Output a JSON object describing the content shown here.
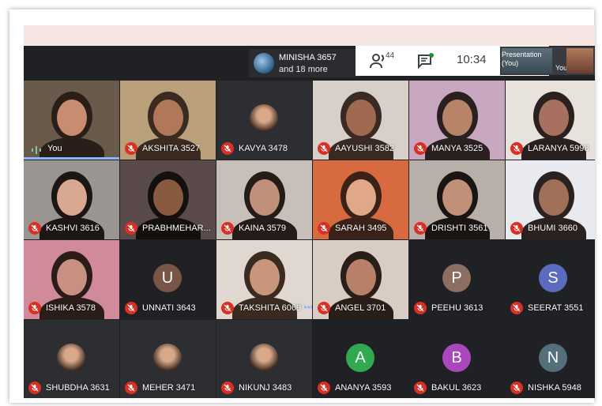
{
  "presenter": {
    "name": "MINISHA 3657",
    "more": "and 18 more"
  },
  "controls": {
    "people_count": "44",
    "time": "10:34"
  },
  "presentation_thumb": {
    "label_line1": "Presentation",
    "label_line2": "(You)",
    "you": "You"
  },
  "tiles": [
    {
      "name": "You",
      "type": "video",
      "self": true
    },
    {
      "name": "AKSHITA 3527",
      "type": "video"
    },
    {
      "name": "KAVYA 3478",
      "type": "photo"
    },
    {
      "name": "AAYUSHI 3582",
      "type": "video"
    },
    {
      "name": "MANYA 3525",
      "type": "video"
    },
    {
      "name": "LARANYA 5998",
      "type": "video"
    },
    {
      "name": "KASHVI 3616",
      "type": "video"
    },
    {
      "name": "PRABHMEHAR...",
      "type": "video"
    },
    {
      "name": "KAINA 3579",
      "type": "video"
    },
    {
      "name": "SARAH 3495",
      "type": "video"
    },
    {
      "name": "DRISHTI 3561",
      "type": "video"
    },
    {
      "name": "BHUMI 3660",
      "type": "video"
    },
    {
      "name": "ISHIKA 3578",
      "type": "video"
    },
    {
      "name": "UNNATI 3643",
      "type": "letter",
      "letter": "U",
      "color": "#795548"
    },
    {
      "name": "TAKSHITA 6069",
      "type": "video"
    },
    {
      "name": "ANGEL 3701",
      "type": "video"
    },
    {
      "name": "PEEHU 3613",
      "type": "letter",
      "letter": "P",
      "color": "#8d6e63"
    },
    {
      "name": "SEERAT 3551",
      "type": "letter",
      "letter": "S",
      "color": "#5c6bc0"
    },
    {
      "name": "SHUBDHA 3631",
      "type": "photo"
    },
    {
      "name": "MEHER 3471",
      "type": "photo"
    },
    {
      "name": "NIKUNJ 3483",
      "type": "photo"
    },
    {
      "name": "ANANYA 3593",
      "type": "letter",
      "letter": "A",
      "color": "#33a852"
    },
    {
      "name": "BAKUL 3623",
      "type": "letter",
      "letter": "B",
      "color": "#ab47bc"
    },
    {
      "name": "NISHKA 5948",
      "type": "letter",
      "letter": "N",
      "color": "#546e7a"
    }
  ],
  "colors": {
    "meet_bg": "#202124",
    "mute_red": "#d93025",
    "highlight_blue": "#8ab4f8"
  }
}
